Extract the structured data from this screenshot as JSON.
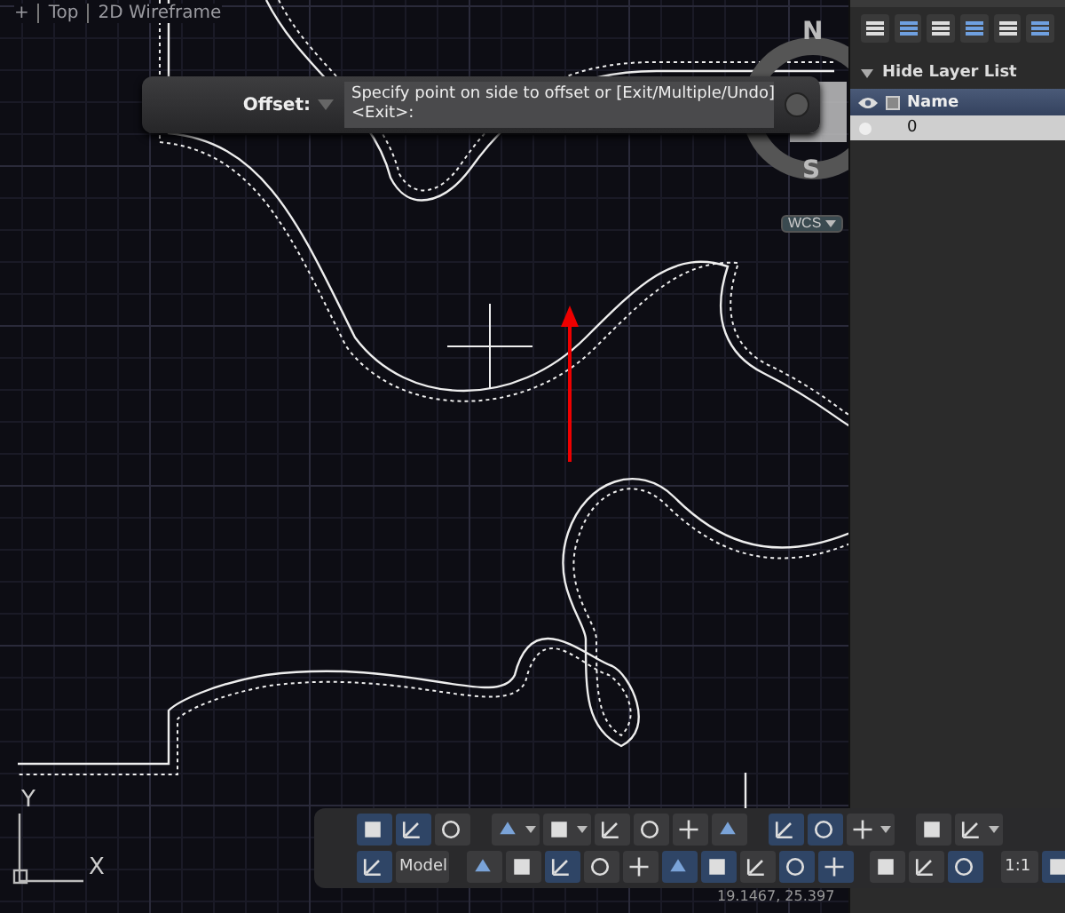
{
  "viewport_label": {
    "toggle": "+",
    "view": "Top",
    "style": "2D Wireframe"
  },
  "command": {
    "label": "Offset:",
    "prompt": [
      "Specify point on side to offset or [Exit/Multiple/Undo]",
      "<Exit>:"
    ]
  },
  "viewcube": {
    "north": "N",
    "south": "S",
    "ucs": "WCS"
  },
  "ucs_icon": {
    "x": "X",
    "y": "Y"
  },
  "toolbar": {
    "rows": [
      [
        {
          "kind": "button",
          "selected": true
        },
        {
          "kind": "button",
          "selected": true
        },
        {
          "kind": "button",
          "selected": false
        },
        {
          "kind": "gap"
        },
        {
          "kind": "button",
          "selected": false,
          "menu": true
        },
        {
          "kind": "button",
          "selected": false,
          "menu": true
        },
        {
          "kind": "button",
          "selected": false
        },
        {
          "kind": "button",
          "selected": false
        },
        {
          "kind": "button",
          "selected": false
        },
        {
          "kind": "button",
          "selected": false
        },
        {
          "kind": "gap"
        },
        {
          "kind": "button",
          "selected": true
        },
        {
          "kind": "button",
          "selected": true
        },
        {
          "kind": "button",
          "selected": false,
          "menu": true
        },
        {
          "kind": "gap"
        },
        {
          "kind": "button",
          "selected": false
        },
        {
          "kind": "button",
          "selected": false,
          "menu": true
        }
      ],
      [
        {
          "kind": "button",
          "selected": true
        },
        {
          "kind": "menu",
          "label": "Model"
        },
        {
          "kind": "gap"
        },
        {
          "kind": "button",
          "selected": false
        },
        {
          "kind": "button",
          "selected": false
        },
        {
          "kind": "button",
          "selected": true
        },
        {
          "kind": "button",
          "selected": false
        },
        {
          "kind": "button",
          "selected": false
        },
        {
          "kind": "button",
          "selected": true
        },
        {
          "kind": "button",
          "selected": true
        },
        {
          "kind": "button",
          "selected": false
        },
        {
          "kind": "button",
          "selected": true
        },
        {
          "kind": "button",
          "selected": true
        },
        {
          "kind": "gap"
        },
        {
          "kind": "button",
          "selected": false
        },
        {
          "kind": "button",
          "selected": false
        },
        {
          "kind": "button",
          "selected": true
        },
        {
          "kind": "gap"
        },
        {
          "kind": "menu",
          "label": "1:1"
        },
        {
          "kind": "button",
          "selected": true
        }
      ]
    ]
  },
  "coordinates": "19.1467, 25.397",
  "layers": {
    "toggle": {
      "label": "Hide Layer List",
      "expanded": true
    },
    "columns": [
      "Name"
    ],
    "rows": [
      {
        "name": "0",
        "selected": false
      }
    ]
  }
}
